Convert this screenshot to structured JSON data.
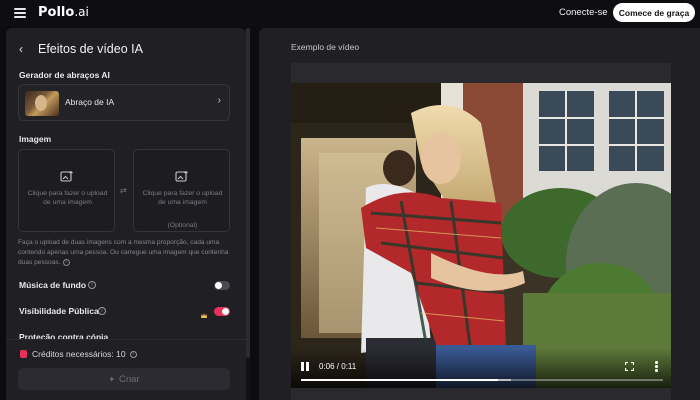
{
  "header": {
    "logo_main": "Pollo",
    "logo_suffix": ".ai",
    "login": "Conecte-se",
    "signup": "Comece de graça"
  },
  "sidebar": {
    "title": "Efeitos de vídeo IA",
    "generator_label": "Gerador de abraços AI",
    "template_name": "Abraço de IA",
    "image_label": "Imagem",
    "upload_text": "Clique para fazer o upload de uma imagem",
    "upload_optional": "(Optional)",
    "hint": "Faça o upload de duas imagens com a mesma proporção, cada uma contendo apenas uma pessoa. Ou carregue uma imagem que contenha duas pessoas.",
    "music_label": "Música de fundo",
    "music_enabled": false,
    "visibility_label": "Visibilidade Pública",
    "visibility_enabled": true,
    "protection_label": "Proteção contra cópia",
    "credits": "Créditos necessários: 10",
    "create_label": "Criar"
  },
  "preview": {
    "label": "Exemplo de vídeo",
    "time": "0:06 / 0:11",
    "progress_fraction": 0.545,
    "buffered_fraction": 0.58
  },
  "colors": {
    "accent": "#e8315a",
    "panel": "#1f1f24",
    "background": "#0c0c10"
  },
  "icons": [
    "menu-icon",
    "chevron-left-icon",
    "chevron-right-icon",
    "image-upload-icon",
    "swap-icon",
    "info-icon",
    "coin-icon",
    "sparkle-icon",
    "pause-icon",
    "fullscreen-icon",
    "more-vertical-icon"
  ]
}
